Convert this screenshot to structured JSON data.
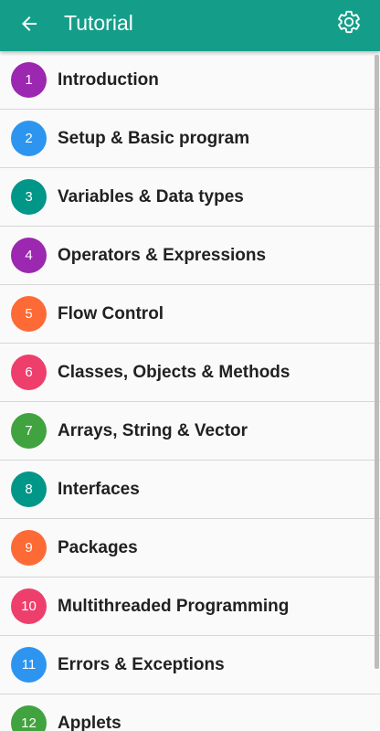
{
  "toolbar": {
    "title": "Tutorial",
    "color": "#149e8a",
    "back_icon": "arrow-left-icon",
    "settings_icon": "gear-icon"
  },
  "items": [
    {
      "number": "1",
      "label": "Introduction",
      "color": "#9c27b0"
    },
    {
      "number": "2",
      "label": "Setup & Basic program",
      "color": "#2d95ef"
    },
    {
      "number": "3",
      "label": "Variables & Data types",
      "color": "#009688"
    },
    {
      "number": "4",
      "label": "Operators & Expressions",
      "color": "#9c27b0"
    },
    {
      "number": "5",
      "label": "Flow Control",
      "color": "#fd6a35"
    },
    {
      "number": "6",
      "label": "Classes, Objects & Methods",
      "color": "#ee3f6c"
    },
    {
      "number": "7",
      "label": "Arrays, String & Vector",
      "color": "#40a33f"
    },
    {
      "number": "8",
      "label": "Interfaces",
      "color": "#009688"
    },
    {
      "number": "9",
      "label": "Packages",
      "color": "#fd6a35"
    },
    {
      "number": "10",
      "label": "Multithreaded Programming",
      "color": "#ee3f6c"
    },
    {
      "number": "11",
      "label": "Errors & Exceptions",
      "color": "#2d95ef"
    },
    {
      "number": "12",
      "label": "Applets",
      "color": "#40a33f"
    }
  ]
}
